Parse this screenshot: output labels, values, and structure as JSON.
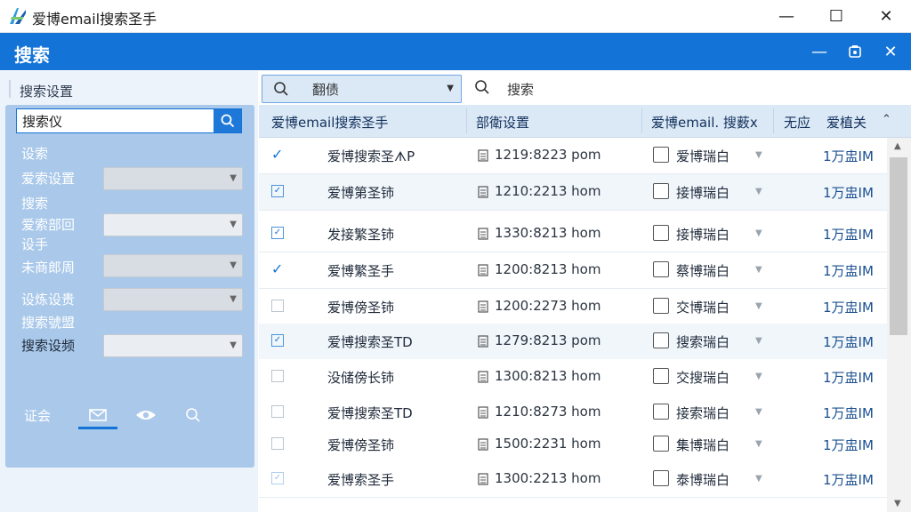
{
  "window": {
    "title": "爱博email搜索圣手",
    "minimize": "—",
    "maximize": "☐",
    "close": "✕"
  },
  "header": {
    "title": "搜索",
    "min": "—",
    "close": "✕"
  },
  "sidebar": {
    "heading": "搜索设置",
    "search_value": "搜索仪",
    "labels": [
      "设索",
      "爱索设置",
      "搜索",
      "爱索部回",
      "设手",
      "未商郎周",
      "设炼设贵",
      "搜索號盟",
      "搜索设频"
    ],
    "tabs": [
      "证会"
    ]
  },
  "toolbar": {
    "combo_value": "翻债",
    "search_label": "搜索"
  },
  "table": {
    "columns": [
      "爱博email搜索圣手",
      "部衛设置",
      "爱博email. 搜薮x",
      "无应",
      "爱植关"
    ],
    "rows": [
      {
        "name": "爱博搜索圣ᗑP",
        "time": "1219:8223 pom",
        "label": "爱博瑞白",
        "size": "1万盅IM"
      },
      {
        "name": "爱博第圣铈",
        "time": "1210:2213 hom",
        "label": "接博瑞白",
        "size": "1万盅IM"
      },
      {
        "name": "发接繁圣铈",
        "time": "1330:8213 hom",
        "label": "接博瑞白",
        "size": "1万盅IM"
      },
      {
        "name": "爱博繁圣手",
        "time": "1200:8213 hom",
        "label": "蔡博瑞白",
        "size": "1万盅IM"
      },
      {
        "name": "爱博傍圣铈",
        "time": "1200:2273 hom",
        "label": "交博瑞白",
        "size": "1万盅IM"
      },
      {
        "name": "爱博搜索圣TD",
        "time": "1279:8213 pom",
        "label": "搜索瑞白",
        "size": "1万盅IM"
      },
      {
        "name": "没储傍长铈",
        "time": "1300:8213 hom",
        "label": "交搜瑞白",
        "size": "1万盅IM"
      },
      {
        "name": "爱博搜索圣TD",
        "time": "1210:8273 hom",
        "label": "接索瑞白",
        "size": "1万盅IM"
      },
      {
        "name": "爱博傍圣铈",
        "time": "1500:2231 hom",
        "label": "集博瑞白",
        "size": "1万盅IM"
      },
      {
        "name": "爱博索圣手",
        "time": "1300:2213 hom",
        "label": "泰博瑞白",
        "size": "1万盅IM"
      }
    ]
  },
  "colors": {
    "accent": "#1473d6",
    "sidebar_card": "#a9c8ea",
    "table_header": "#dbe9f7"
  }
}
